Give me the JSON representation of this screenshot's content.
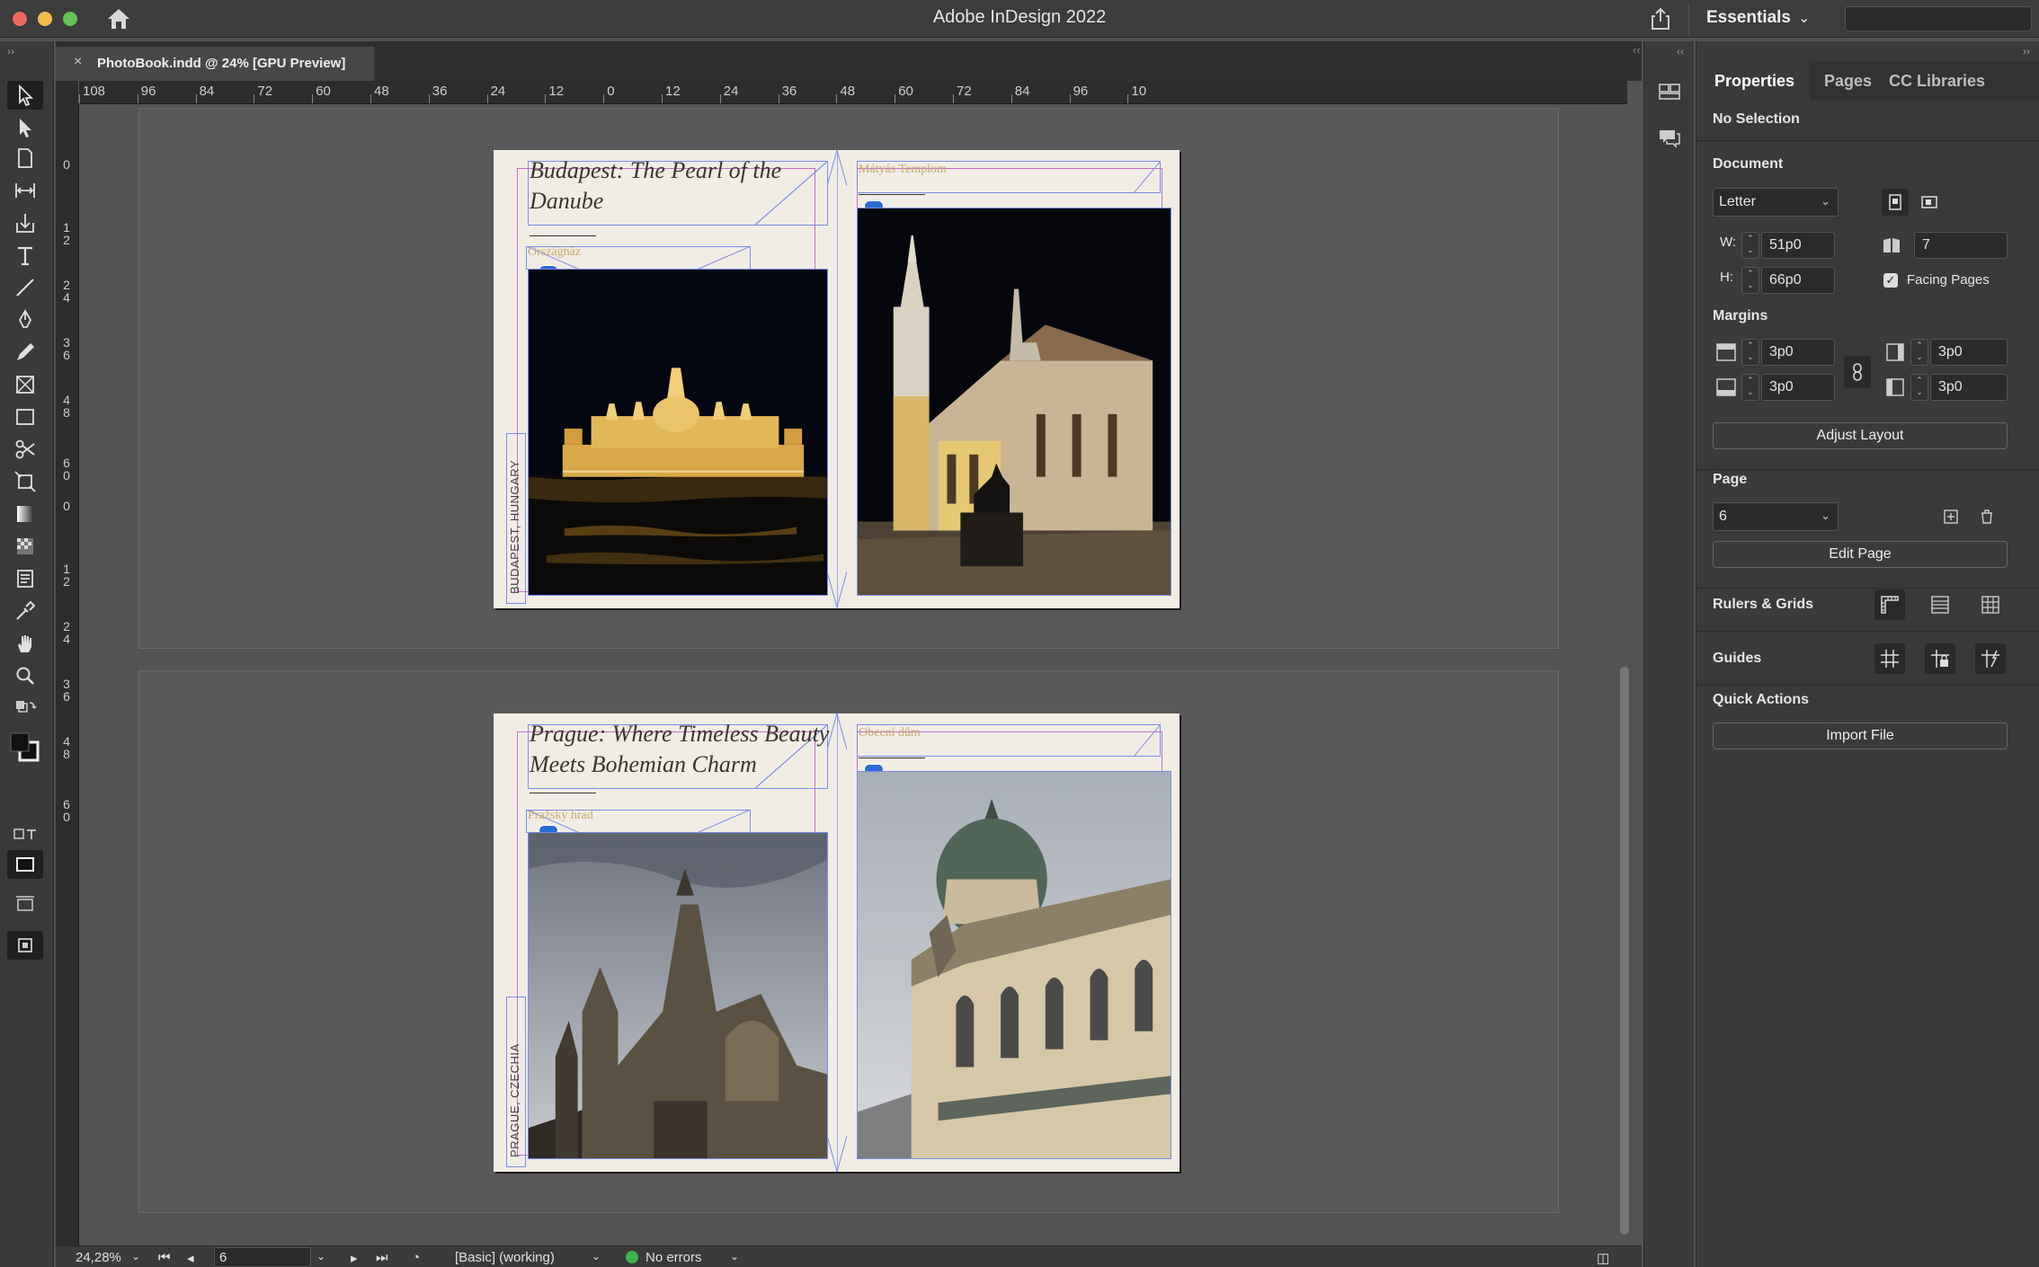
{
  "app": {
    "title": "Adobe InDesign 2022",
    "workspace": "Essentials"
  },
  "document_tab": {
    "close": "×",
    "name": "PhotoBook.indd @ 24% [GPU Preview]"
  },
  "ruler_top": [
    "108",
    "96",
    "84",
    "72",
    "60",
    "48",
    "36",
    "24",
    "12",
    "0",
    "12",
    "24",
    "36",
    "48",
    "60",
    "72",
    "84",
    "96",
    "10"
  ],
  "ruler_left": [
    "0",
    "1\n2",
    "2\n4",
    "3\n6",
    "4\n8",
    "6\n0",
    "0",
    "1\n2",
    "2\n4",
    "3\n6",
    "4\n8",
    "6\n0"
  ],
  "spreads": [
    {
      "headline": "Budapest: The Pearl of the Danube",
      "left_caption": "Országház",
      "side_label": "BUDAPEST, HUNGARY",
      "right_caption": "Mátyás Templom"
    },
    {
      "headline": "Prague: Where Timeless Beauty Meets Bohemian Charm",
      "left_caption": "Pražský hrad",
      "side_label": "PRAGUE, CZECHIA",
      "right_caption": "Obecní dům"
    }
  ],
  "panel": {
    "tabs": [
      "Properties",
      "Pages",
      "CC Libraries"
    ],
    "selection": "No Selection",
    "document_heading": "Document",
    "page_size": "Letter",
    "w_label": "W:",
    "width": "51p0",
    "h_label": "H:",
    "height": "66p0",
    "pages_count": "7",
    "facing_pages_label": "Facing Pages",
    "facing_pages_checked": true,
    "margins_heading": "Margins",
    "margin_top": "3p0",
    "margin_bottom": "3p0",
    "margin_inside": "3p0",
    "margin_outside": "3p0",
    "adjust_layout": "Adjust Layout",
    "page_heading": "Page",
    "current_page": "6",
    "edit_page": "Edit Page",
    "rulers_grids": "Rulers & Grids",
    "guides": "Guides",
    "quick_actions": "Quick Actions",
    "import_file": "Import File"
  },
  "status": {
    "zoom": "24,28%",
    "page": "6",
    "preflight_profile": "[Basic] (working)",
    "errors": "No errors"
  },
  "colors": {
    "preflight_ok": "#3bb54a",
    "margin_guide": "#c36ec9",
    "frame_edge": "#7a8ce8",
    "caption": "#c7a96a"
  }
}
